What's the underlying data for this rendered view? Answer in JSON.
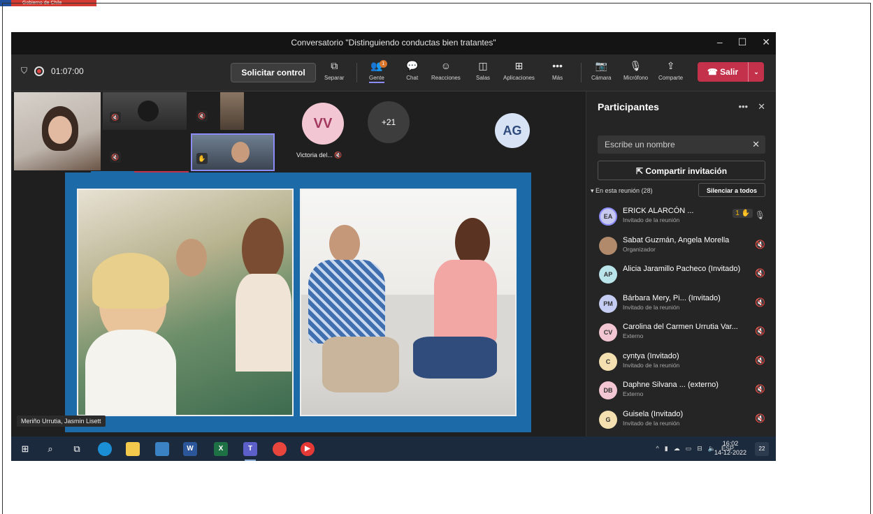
{
  "window_title": "Conversatorio \"Distinguiendo conductas bien tratantes\"",
  "logo_text": "Gobierno de Chile",
  "window_controls": [
    "–",
    "☐",
    "✕"
  ],
  "timer": "01:07:00",
  "solicitar_label": "Solicitar control",
  "toolbar": {
    "separar": "Separar",
    "gente": "Gente",
    "gente_badge": "1",
    "chat": "Chat",
    "reacciones": "Reacciones",
    "salas": "Salas",
    "aplicaciones": "Aplicaciones",
    "mas": "Más",
    "camara": "Cámara",
    "microfono": "Micrófono",
    "comparte": "Comparte",
    "salir": "Salir"
  },
  "stage": {
    "vv_initials": "VV",
    "vv_name": "Victoria del...",
    "overflow": "+21",
    "ag_initials": "AG",
    "name_chip": "Meriño Urrutia, Jasmin Lisett"
  },
  "panel": {
    "title": "Participantes",
    "search_placeholder": "Escribe un nombre",
    "invite_label": "Compartir invitación",
    "in_meeting": "▾ En esta reunión (28)",
    "mute_all": "Silenciar a todos",
    "participants": [
      {
        "initials": "EA",
        "name": "ERICK ALARCÓN ...",
        "role": "Invitado de la reunión",
        "color": "#c7c9f0",
        "hand": "1 ✋",
        "mic": "🎙"
      },
      {
        "initials": "",
        "name": "Sabat Guzmán, Angela Morella",
        "role": "Organizador",
        "color": "#b08a6a",
        "hand": "",
        "mic": "🔇"
      },
      {
        "initials": "AP",
        "name": "Alicia Jaramillo Pacheco (Invitado)",
        "role": "",
        "color": "#b9e4ea",
        "hand": "",
        "mic": "🔇"
      },
      {
        "initials": "PM",
        "name": "Bárbara Mery, Pi...  (Invitado)",
        "role": "Invitado de la reunión",
        "color": "#c5cdf2",
        "hand": "",
        "mic": "🔇"
      },
      {
        "initials": "CV",
        "name": "Carolina del Carmen Urrutia Var...",
        "role": "Externo",
        "color": "#f3c6d4",
        "hand": "",
        "mic": "🔇"
      },
      {
        "initials": "C",
        "name": "cyntya (Invitado)",
        "role": "Invitado de la reunión",
        "color": "#f3dfb0",
        "hand": "",
        "mic": "🔇"
      },
      {
        "initials": "DB",
        "name": "Daphne Silvana ...  (externo)",
        "role": "Externo",
        "color": "#f3c6d4",
        "hand": "",
        "mic": "🔇"
      },
      {
        "initials": "G",
        "name": "Guisela (Invitado)",
        "role": "Invitado de la reunión",
        "color": "#f3dfb0",
        "hand": "",
        "mic": "🔇"
      }
    ]
  },
  "taskbar": {
    "lang": "ESP",
    "time": "16:02",
    "date": "14-12-2022",
    "notifications": "22"
  }
}
